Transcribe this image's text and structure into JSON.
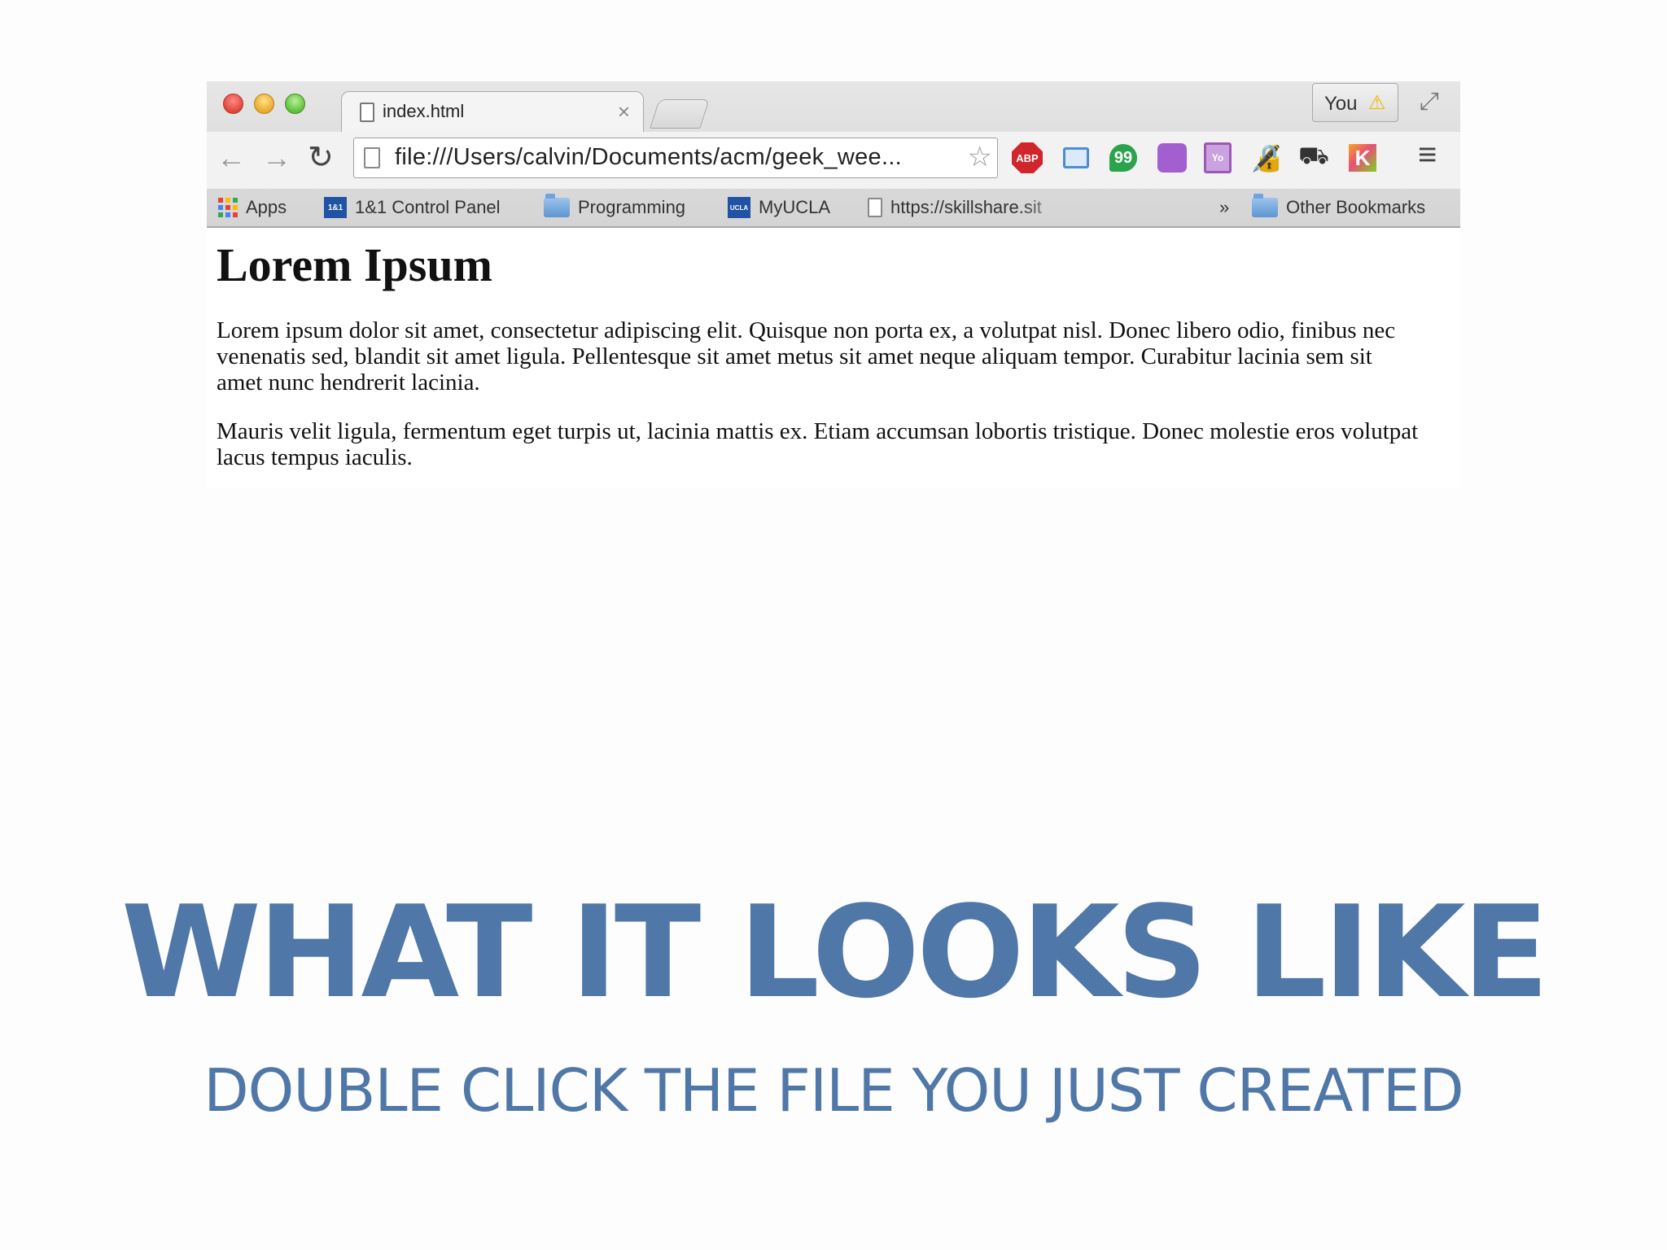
{
  "browser": {
    "tab": {
      "title": "index.html",
      "close": "×"
    },
    "profile": {
      "name": "You",
      "warning_icon": "warning-icon"
    },
    "toolbar": {
      "back": "←",
      "forward": "→",
      "reload": "C",
      "url": "file:///Users/calvin/Documents/acm/geek_wee...",
      "star": "☆",
      "menu": "≡",
      "extensions": {
        "abp": "ABP",
        "hangouts": "99",
        "yo": "Yo",
        "k": "K"
      }
    },
    "bookmarks": {
      "apps": "Apps",
      "item1_badge": "1&1",
      "item1": "1&1 Control Panel",
      "item2": "Programming",
      "item3_badge": "UCLA",
      "item3": "MyUCLA",
      "item4": "https://skillshare.sit",
      "overflow": "»",
      "other": "Other Bookmarks"
    },
    "apps_colors": [
      "#e94235",
      "#fbbc05",
      "#34a853",
      "#4285f4",
      "#e94235",
      "#fbbc05",
      "#34a853",
      "#4285f4",
      "#e94235"
    ]
  },
  "page": {
    "heading": "Lorem Ipsum",
    "paragraph1": "Lorem ipsum dolor sit amet, consectetur adipiscing elit. Quisque non porta ex, a volutpat nisl. Donec libero odio, finibus nec venenatis sed, blandit sit amet ligula. Pellentesque sit amet metus sit amet neque aliquam tempor. Curabitur lacinia sem sit amet nunc hendrerit lacinia.",
    "paragraph2": "Mauris velit ligula, fermentum eget turpis ut, lacinia mattis ex. Etiam accumsan lobortis tristique. Donec molestie eros volutpat lacus tempus iaculis."
  },
  "slide": {
    "title": "WHAT IT LOOKS LIKE",
    "subtitle": "DOUBLE CLICK THE FILE YOU JUST CREATED",
    "accent_color": "#4f77a7"
  }
}
